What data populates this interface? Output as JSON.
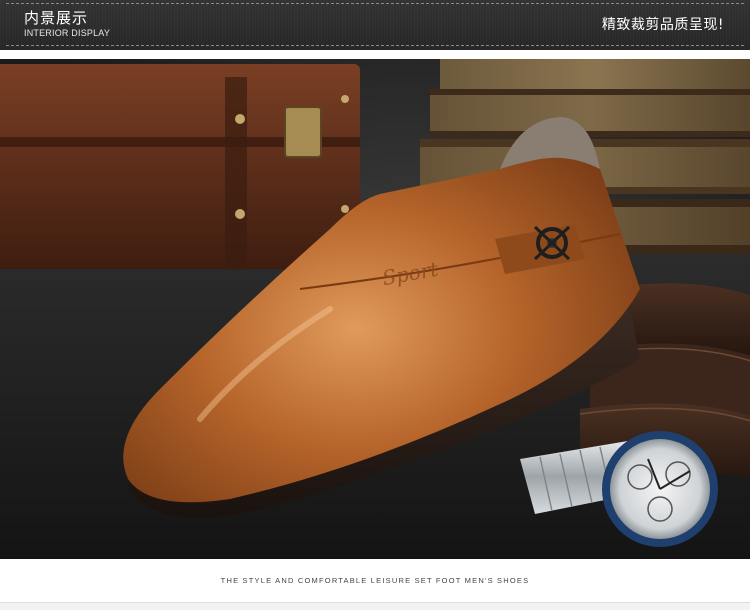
{
  "header": {
    "title_cn": "内景展示",
    "title_en": "INTERIOR DISPLAY",
    "slogan": "精致裁剪品质呈现!"
  },
  "product": {
    "brand_emboss": "Sport"
  },
  "footer": {
    "tagline": "THE STYLE AND COMFORTABLE LEISURE SET FOOT MEN'S SHOES"
  }
}
